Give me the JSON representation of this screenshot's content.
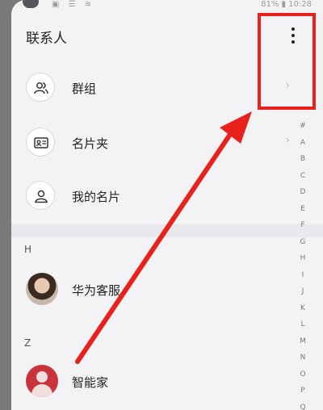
{
  "status_bar": {
    "left_icons": "▣ ☰ ≋",
    "battery_time": "81% ▮ 10:28"
  },
  "header": {
    "title": "联系人"
  },
  "menu": {
    "items": [
      {
        "label": "群组",
        "icon": "group-icon"
      },
      {
        "label": "名片夹",
        "icon": "card-holder-icon"
      },
      {
        "label": "我的名片",
        "icon": "person-icon"
      }
    ]
  },
  "sections": [
    {
      "letter": "H",
      "contacts": [
        {
          "name": "华为客服",
          "avatar": "photo"
        }
      ]
    },
    {
      "letter": "Z",
      "contacts": [
        {
          "name": "智能家",
          "avatar": "default-red"
        }
      ]
    }
  ],
  "alpha_index": [
    "#",
    "A",
    "B",
    "C",
    "D",
    "E",
    "F",
    "G",
    "H",
    "I",
    "J",
    "K",
    "L",
    "M",
    "N",
    "O",
    "P",
    "Q"
  ],
  "colors": {
    "highlight": "#e8211d",
    "background": "#f3f3f6",
    "accent_red": "#c9343a"
  }
}
